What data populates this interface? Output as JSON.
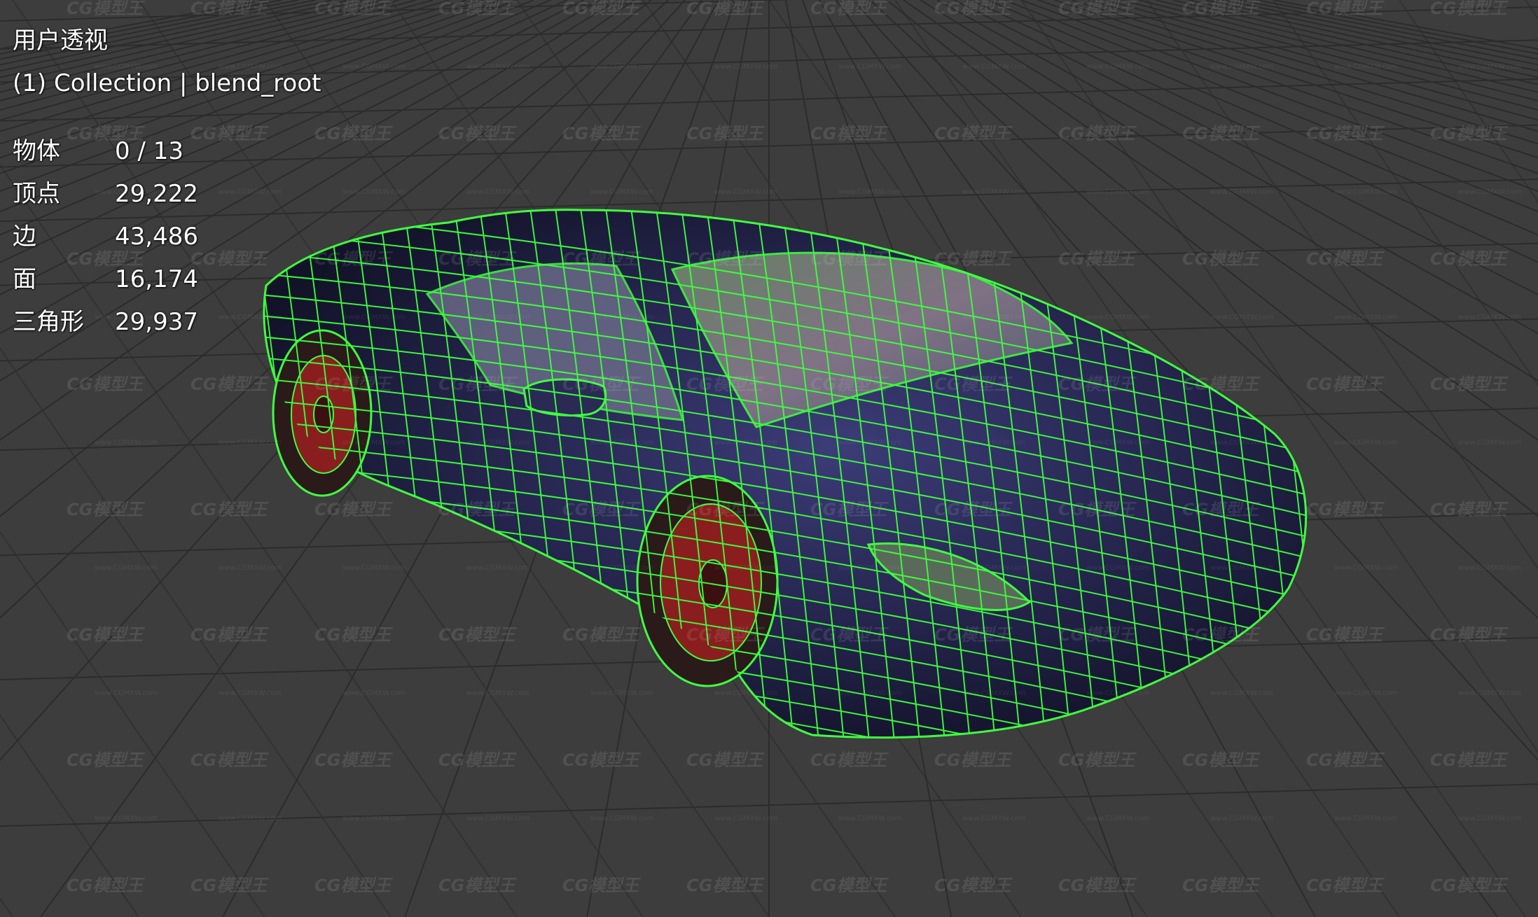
{
  "viewport": {
    "view_name": "用户透视",
    "collection_label": "(1) Collection | blend_root",
    "background": "#3d3d3d",
    "grid_color": "#2c2c2c",
    "wireframe_color": "#3fff3f",
    "body_color": "#23234a",
    "wheel_color": "#8a1e1e"
  },
  "stats": [
    {
      "label": "物体",
      "value": "0 / 13"
    },
    {
      "label": "顶点",
      "value": "29,222"
    },
    {
      "label": "边",
      "value": "43,486"
    },
    {
      "label": "面",
      "value": "16,174"
    },
    {
      "label": "三角形",
      "value": "29,937"
    }
  ],
  "watermark": {
    "logo_text": "CG模型王",
    "url_text": "www.CGMXW.com"
  }
}
